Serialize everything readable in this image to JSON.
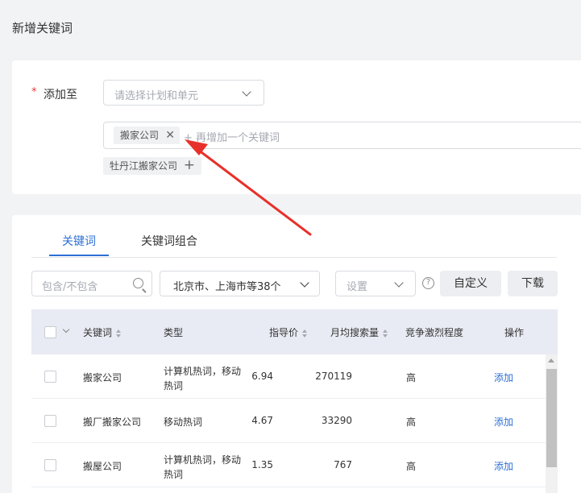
{
  "page_title": "新增关键词",
  "form": {
    "required_mark": "*",
    "add_to_label": "添加至",
    "plan_select_placeholder": "请选择计划和单元",
    "selected_keyword_tag": "搬家公司",
    "tag_remove_symbol": "✕",
    "add_keyword_placeholder": "+ 再增加一个关键词",
    "suggested_tag": "牡丹江搬家公司",
    "suggested_add_symbol": "+"
  },
  "tabs": [
    {
      "label": "关键词",
      "active": true
    },
    {
      "label": "关键词组合",
      "active": false
    }
  ],
  "filters": {
    "include_placeholder": "包含/不包含",
    "region_value": "北京市、上海市等38个",
    "settings_placeholder": "设置",
    "help_symbol": "?",
    "custom_button": "自定义",
    "download_button": "下载"
  },
  "table": {
    "headers": {
      "keyword": "关键词",
      "type": "类型",
      "price": "指导价",
      "volume": "月均搜索量",
      "competition": "竞争激烈程度",
      "action": "操作"
    },
    "rows": [
      {
        "keyword": "搬家公司",
        "type": "计算机热词，移动热词",
        "price": "6.94",
        "volume": "270119",
        "competition": "高",
        "action": "添加"
      },
      {
        "keyword": "搬厂搬家公司",
        "type": "移动热词",
        "price": "4.67",
        "volume": "33290",
        "competition": "高",
        "action": "添加"
      },
      {
        "keyword": "搬屋公司",
        "type": "计算机热词，移动热词",
        "price": "1.35",
        "volume": "767",
        "competition": "高",
        "action": "添加"
      }
    ]
  },
  "colors": {
    "accent": "#2d6fd6",
    "annotation_arrow": "#e8302a",
    "required": "#e4393c"
  }
}
